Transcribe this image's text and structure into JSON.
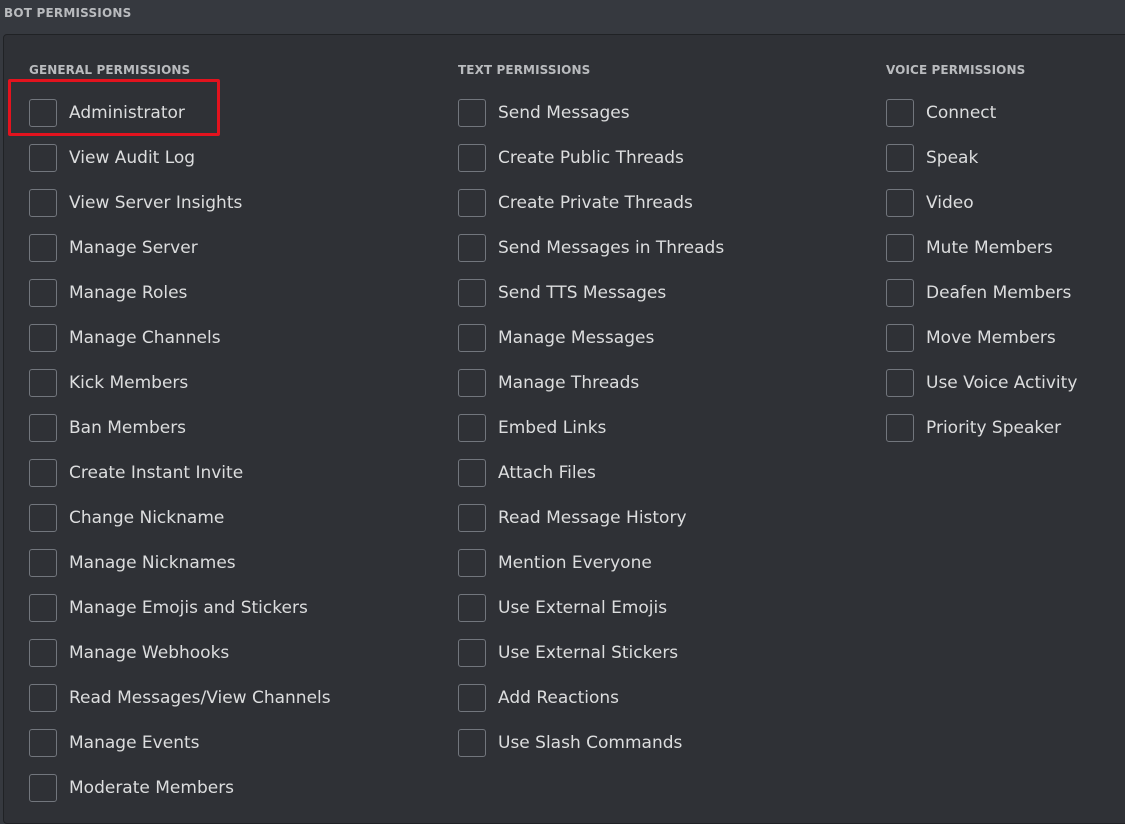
{
  "section_title": "BOT PERMISSIONS",
  "columns": [
    {
      "header": "GENERAL PERMISSIONS",
      "items": [
        {
          "label": "Administrator"
        },
        {
          "label": "View Audit Log"
        },
        {
          "label": "View Server Insights"
        },
        {
          "label": "Manage Server"
        },
        {
          "label": "Manage Roles"
        },
        {
          "label": "Manage Channels"
        },
        {
          "label": "Kick Members"
        },
        {
          "label": "Ban Members"
        },
        {
          "label": "Create Instant Invite"
        },
        {
          "label": "Change Nickname"
        },
        {
          "label": "Manage Nicknames"
        },
        {
          "label": "Manage Emojis and Stickers"
        },
        {
          "label": "Manage Webhooks"
        },
        {
          "label": "Read Messages/View Channels"
        },
        {
          "label": "Manage Events"
        },
        {
          "label": "Moderate Members"
        }
      ]
    },
    {
      "header": "TEXT PERMISSIONS",
      "items": [
        {
          "label": "Send Messages"
        },
        {
          "label": "Create Public Threads"
        },
        {
          "label": "Create Private Threads"
        },
        {
          "label": "Send Messages in Threads"
        },
        {
          "label": "Send TTS Messages"
        },
        {
          "label": "Manage Messages"
        },
        {
          "label": "Manage Threads"
        },
        {
          "label": "Embed Links"
        },
        {
          "label": "Attach Files"
        },
        {
          "label": "Read Message History"
        },
        {
          "label": "Mention Everyone"
        },
        {
          "label": "Use External Emojis"
        },
        {
          "label": "Use External Stickers"
        },
        {
          "label": "Add Reactions"
        },
        {
          "label": "Use Slash Commands"
        }
      ]
    },
    {
      "header": "VOICE PERMISSIONS",
      "items": [
        {
          "label": "Connect"
        },
        {
          "label": "Speak"
        },
        {
          "label": "Video"
        },
        {
          "label": "Mute Members"
        },
        {
          "label": "Deafen Members"
        },
        {
          "label": "Move Members"
        },
        {
          "label": "Use Voice Activity"
        },
        {
          "label": "Priority Speaker"
        }
      ]
    }
  ],
  "colors": {
    "background": "#36393f",
    "panel": "#2f3136",
    "checkbox_border": "#72767d",
    "highlight": "#e3131e"
  },
  "checked": {
    "general": [
      false,
      false,
      false,
      false,
      false,
      false,
      false,
      false,
      false,
      false,
      false,
      false,
      false,
      false,
      false,
      false
    ],
    "text": [
      false,
      false,
      false,
      false,
      false,
      false,
      false,
      false,
      false,
      false,
      false,
      false,
      false,
      false,
      false
    ],
    "voice": [
      false,
      false,
      false,
      false,
      false,
      false,
      false,
      false
    ]
  }
}
